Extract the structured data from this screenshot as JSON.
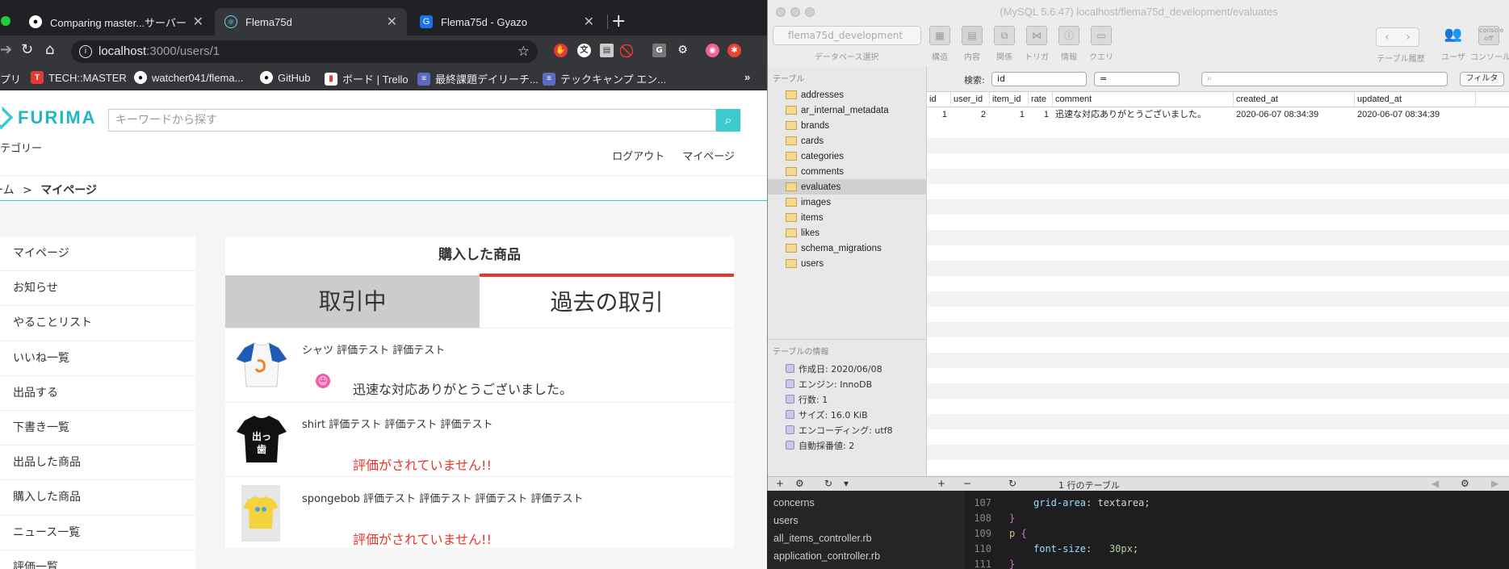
{
  "chrome": {
    "tabs": [
      {
        "title": "Comparing master...サーバー",
        "icon": "github-icon"
      },
      {
        "title": "Flema75d",
        "icon": "react-icon"
      },
      {
        "title": "Flema75d - Gyazo",
        "icon": "gyazo-icon"
      }
    ],
    "url_host": "localhost",
    "url_path": ":3000/users/1",
    "bookmarks": [
      "プリ",
      "TECH::MASTER",
      "watcher041/flema...",
      "GitHub",
      "ボード | Trello",
      "最終課題デイリーチ...",
      "テックキャンプ エン..."
    ],
    "bookmarks_more": "»"
  },
  "page": {
    "logo_text": "FURIMA",
    "search_placeholder": "キーワードから探す",
    "category": "テゴリー",
    "nav": {
      "logout": "ログアウト",
      "mypage": "マイページ"
    },
    "breadcrumb": {
      "home": "ーム",
      "sep": ">",
      "current": "マイページ"
    },
    "sidebar": [
      "マイページ",
      "お知らせ",
      "やることリスト",
      "いいね一覧",
      "出品する",
      "下書き一覧",
      "出品した商品",
      "購入した商品",
      "ニュース一覧",
      "評価一覧"
    ],
    "panel_title": "購入した商品",
    "tab_active_label": "取引中",
    "tab_past_label": "過去の取引",
    "items": [
      {
        "name": "シャツ 評価テスト 評価テスト",
        "review": "迅速な対応ありがとうございました。",
        "reviewed": true
      },
      {
        "name": "shirt 評価テスト 評価テスト 評価テスト",
        "review": "評価がされていません!!",
        "reviewed": false
      },
      {
        "name": "spongebob 評価テスト 評価テスト 評価テスト 評価テスト",
        "review": "評価がされていません!!",
        "reviewed": false
      }
    ],
    "accent_color": "#3ccace",
    "alert_color": "#ea352d"
  },
  "sequel": {
    "title": "(MySQL 5.6.47) localhost/flema75d_development/evaluates",
    "database": "flema75d_development",
    "database_label": "データベース選択",
    "toolbar": [
      "構造",
      "内容",
      "関係",
      "トリガ",
      "情報",
      "クエリ"
    ],
    "toolbar_right": [
      "テーブル履歴",
      "ユーザ",
      "コンソール"
    ],
    "tables_header": "テーブル",
    "tables": [
      "addresses",
      "ar_internal_metadata",
      "brands",
      "cards",
      "categories",
      "comments",
      "evaluates",
      "images",
      "items",
      "likes",
      "schema_migrations",
      "users"
    ],
    "selected_table": "evaluates",
    "info_header": "テーブルの情報",
    "info": [
      "作成日: 2020/06/08",
      "エンジン: InnoDB",
      "行数: 1",
      "サイズ: 16.0 KiB",
      "エンコーディング: utf8",
      "自動採番値: 2"
    ],
    "filter": {
      "label": "検索:",
      "field": "id",
      "op": "=",
      "button": "フィルタ"
    },
    "columns": [
      "id",
      "user_id",
      "item_id",
      "rate",
      "comment",
      "created_at",
      "updated_at"
    ],
    "rows": [
      [
        "1",
        "2",
        "1",
        "1",
        "迅速な対応ありがとうございました。",
        "2020-06-07 08:34:39",
        "2020-06-07 08:34:39"
      ]
    ],
    "row_count": "1 行のテーブル"
  },
  "editor": {
    "files": [
      "concerns",
      "users",
      "all_items_controller.rb",
      "application_controller.rb"
    ],
    "lines": [
      "107",
      "108",
      "109",
      "110",
      "111"
    ]
  }
}
